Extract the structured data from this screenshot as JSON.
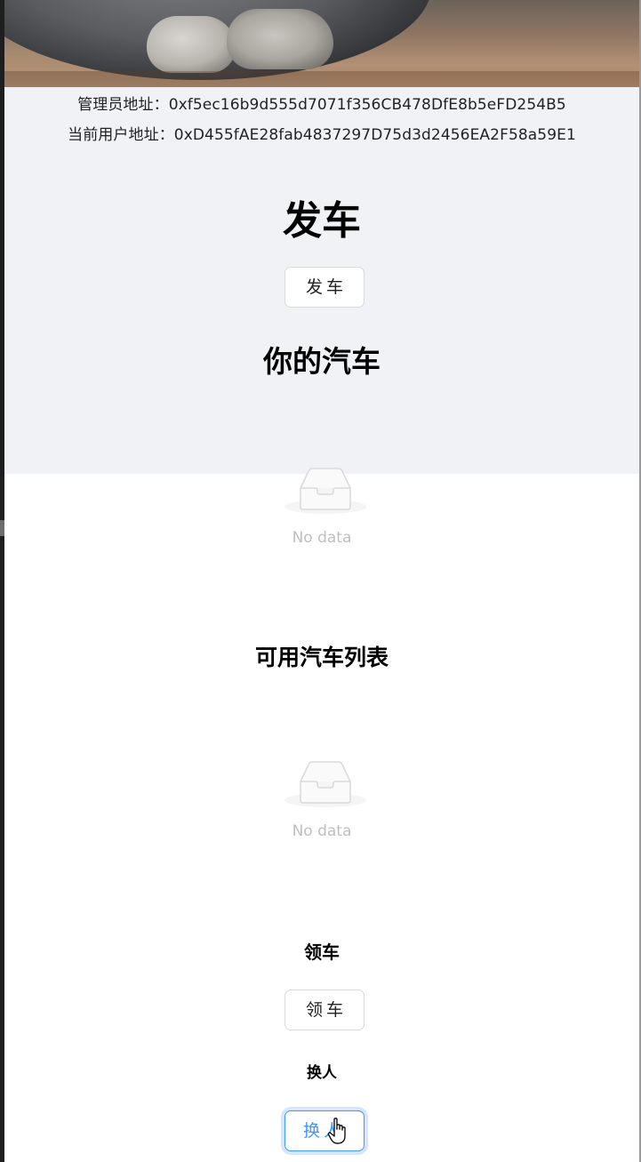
{
  "header": {
    "admin_address": "管理员地址：0xf5ec16b9d555d7071f356CB478DfE8b5eFD254B5",
    "user_address": "当前用户地址：0xD455fAE28fab4837297D75d3d2456EA2F58a59E1"
  },
  "issue": {
    "title": "发车",
    "button_label": "发车"
  },
  "your_cars": {
    "title": "你的汽车",
    "empty_text": "No data"
  },
  "available_cars": {
    "title": "可用汽车列表",
    "empty_text": "No data"
  },
  "get_car": {
    "title": "领车",
    "button_label": "领车"
  },
  "change_owner": {
    "title": "换人",
    "button_label": "换人"
  },
  "icons": {
    "empty": "inbox-empty-icon",
    "cursor": "hand-pointer-icon"
  },
  "colors": {
    "section_bg": "#f0f2f5",
    "primary": "#4096ff",
    "muted_text": "#bfbfbf"
  }
}
